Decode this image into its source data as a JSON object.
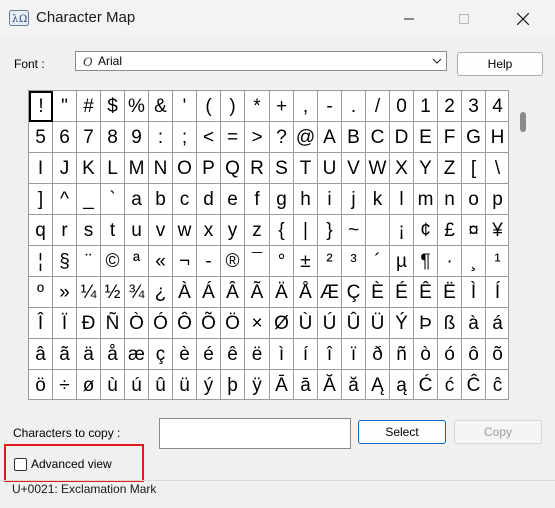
{
  "window": {
    "title": "Character Map"
  },
  "font": {
    "label": "Font :",
    "value": "Arial",
    "icon_glyph": "O"
  },
  "buttons": {
    "help": "Help",
    "select": "Select",
    "copy": "Copy"
  },
  "grid_rows": [
    [
      "!",
      "\"",
      "#",
      "$",
      "%",
      "&",
      "'",
      "(",
      ")",
      "*",
      "+",
      ",",
      "-",
      ".",
      "/",
      "0",
      "1",
      "2",
      "3",
      "4"
    ],
    [
      "5",
      "6",
      "7",
      "8",
      "9",
      ":",
      ";",
      "<",
      "=",
      ">",
      "?",
      "@",
      "A",
      "B",
      "C",
      "D",
      "E",
      "F",
      "G",
      "H"
    ],
    [
      "I",
      "J",
      "K",
      "L",
      "M",
      "N",
      "O",
      "P",
      "Q",
      "R",
      "S",
      "T",
      "U",
      "V",
      "W",
      "X",
      "Y",
      "Z",
      "[",
      "\\"
    ],
    [
      "]",
      "^",
      "_",
      "`",
      "a",
      "b",
      "c",
      "d",
      "e",
      "f",
      "g",
      "h",
      "i",
      "j",
      "k",
      "l",
      "m",
      "n",
      "o",
      "p"
    ],
    [
      "q",
      "r",
      "s",
      "t",
      "u",
      "v",
      "w",
      "x",
      "y",
      "z",
      "{",
      "|",
      "}",
      "~",
      " ",
      "¡",
      "¢",
      "£",
      "¤",
      "¥"
    ],
    [
      "¦",
      "§",
      "¨",
      "©",
      "ª",
      "«",
      "¬",
      "-",
      "®",
      "¯",
      "°",
      "±",
      "²",
      "³",
      "´",
      "µ",
      "¶",
      "·",
      "¸",
      "¹"
    ],
    [
      "º",
      "»",
      "¼",
      "½",
      "¾",
      "¿",
      "À",
      "Á",
      "Â",
      "Ã",
      "Ä",
      "Å",
      "Æ",
      "Ç",
      "È",
      "É",
      "Ê",
      "Ë",
      "Ì",
      "Í"
    ],
    [
      "Î",
      "Ï",
      "Ð",
      "Ñ",
      "Ò",
      "Ó",
      "Ô",
      "Õ",
      "Ö",
      "×",
      "Ø",
      "Ù",
      "Ú",
      "Û",
      "Ü",
      "Ý",
      "Þ",
      "ß",
      "à",
      "á"
    ],
    [
      "â",
      "ã",
      "ä",
      "å",
      "æ",
      "ç",
      "è",
      "é",
      "ê",
      "ë",
      "ì",
      "í",
      "î",
      "ï",
      "ð",
      "ñ",
      "ò",
      "ó",
      "ô",
      "õ"
    ],
    [
      "ö",
      "÷",
      "ø",
      "ù",
      "ú",
      "û",
      "ü",
      "ý",
      "þ",
      "ÿ",
      "Ā",
      "ā",
      "Ă",
      "ă",
      "Ą",
      "ą",
      "Ć",
      "ć",
      "Ĉ",
      "ĉ"
    ]
  ],
  "selected_char": "!",
  "copy": {
    "label": "Characters to copy :",
    "value": ""
  },
  "advanced_view": {
    "label": "Advanced view",
    "checked": false
  },
  "status": "U+0021: Exclamation Mark"
}
